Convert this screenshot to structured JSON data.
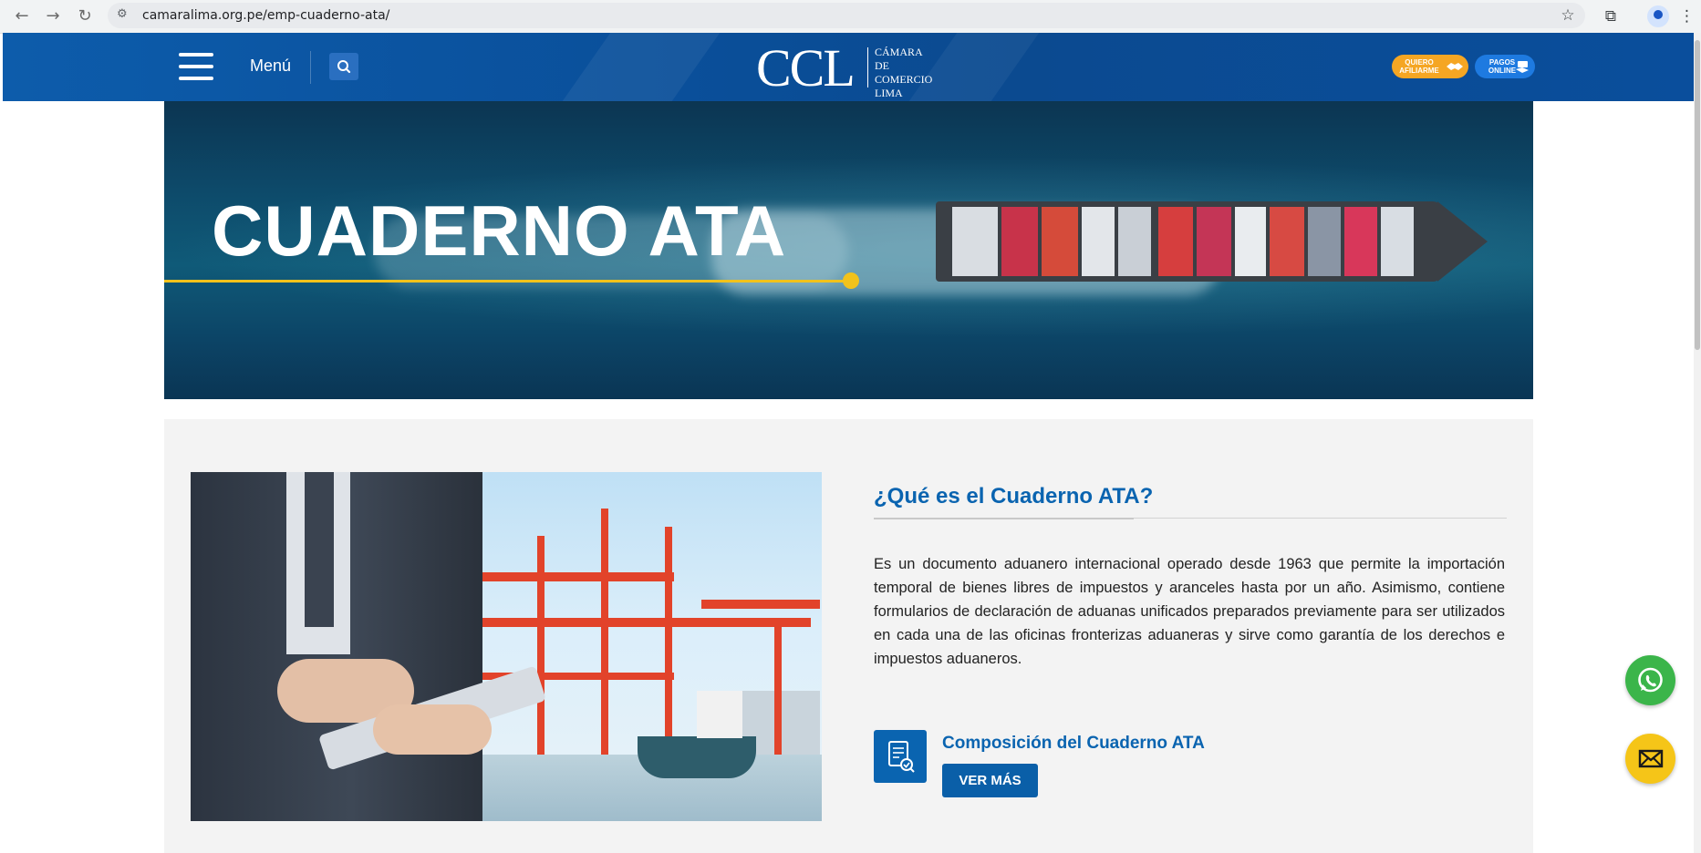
{
  "browser": {
    "back_icon": "←",
    "forward_icon": "→",
    "reload_icon": "↻",
    "site_settings_icon": "⚙",
    "url": "camaralima.org.pe/emp-cuaderno-ata/",
    "bookmark_icon": "☆",
    "extensions_icon": "⧉",
    "menu_icon": "⋮"
  },
  "header": {
    "menu_label": "Menú",
    "logo": {
      "mark": "CCL",
      "line1": "CÁMARA",
      "line2": "DE COMERCIO",
      "line3": "LIMA"
    },
    "afiliarme": {
      "line1": "QUIERO",
      "line2": "AFILIARME"
    },
    "pagos": {
      "line1": "PAGOS",
      "line2": "ONLINE"
    },
    "colors": {
      "header_blue": "#0a4f9a",
      "afiliarme": "#f5a623",
      "pagos": "#1e7ae0"
    }
  },
  "hero": {
    "title": "CUADERNO ATA",
    "accent_color": "#f2c21b"
  },
  "content": {
    "heading": "¿Qué es el Cuaderno ATA?",
    "paragraph": "Es un documento aduanero internacional operado desde 1963 que permite la importación temporal de bienes libres de impuestos y aranceles hasta por un año. Asimismo, contiene formularios de declaración de aduanas unificados preparados previamente para ser utilizados en cada una de las oficinas fronterizas aduaneras y sirve como garantía de los derechos e impuestos aduaneros.",
    "composition_title": "Composición del Cuaderno ATA",
    "ver_mas_label": "VER MÁS",
    "brand_blue": "#0a64b0"
  },
  "floating": {
    "whatsapp_color": "#3bb54a",
    "mail_color": "#f5c518"
  }
}
